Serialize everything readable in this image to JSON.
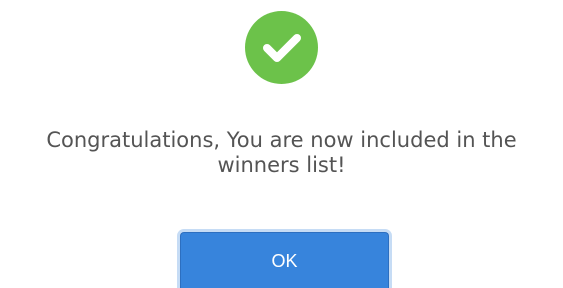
{
  "dialog": {
    "icon": "check-circle-icon",
    "message_line1": "Congratulations, You are now included in the",
    "message_line2": "winners list!",
    "ok_label": "OK"
  },
  "colors": {
    "success": "#6cc24a",
    "button": "#3784dc",
    "text": "#545454"
  }
}
